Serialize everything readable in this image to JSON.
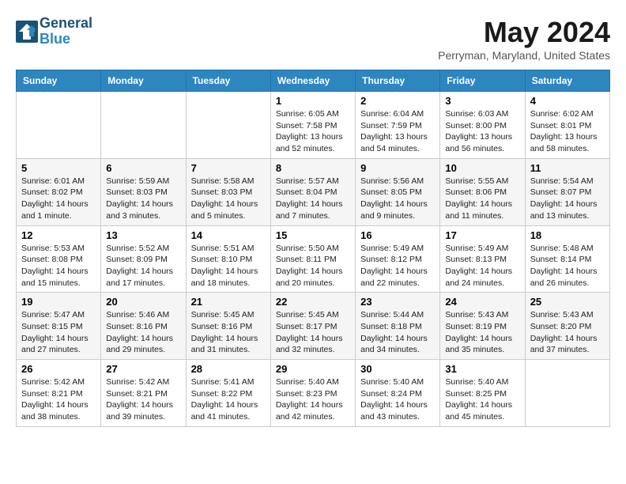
{
  "header": {
    "logo_line1": "General",
    "logo_line2": "Blue",
    "month_title": "May 2024",
    "location": "Perryman, Maryland, United States"
  },
  "days_of_week": [
    "Sunday",
    "Monday",
    "Tuesday",
    "Wednesday",
    "Thursday",
    "Friday",
    "Saturday"
  ],
  "weeks": [
    [
      {
        "day": "",
        "sunrise": "",
        "sunset": "",
        "daylight": ""
      },
      {
        "day": "",
        "sunrise": "",
        "sunset": "",
        "daylight": ""
      },
      {
        "day": "",
        "sunrise": "",
        "sunset": "",
        "daylight": ""
      },
      {
        "day": "1",
        "sunrise": "Sunrise: 6:05 AM",
        "sunset": "Sunset: 7:58 PM",
        "daylight": "Daylight: 13 hours and 52 minutes."
      },
      {
        "day": "2",
        "sunrise": "Sunrise: 6:04 AM",
        "sunset": "Sunset: 7:59 PM",
        "daylight": "Daylight: 13 hours and 54 minutes."
      },
      {
        "day": "3",
        "sunrise": "Sunrise: 6:03 AM",
        "sunset": "Sunset: 8:00 PM",
        "daylight": "Daylight: 13 hours and 56 minutes."
      },
      {
        "day": "4",
        "sunrise": "Sunrise: 6:02 AM",
        "sunset": "Sunset: 8:01 PM",
        "daylight": "Daylight: 13 hours and 58 minutes."
      }
    ],
    [
      {
        "day": "5",
        "sunrise": "Sunrise: 6:01 AM",
        "sunset": "Sunset: 8:02 PM",
        "daylight": "Daylight: 14 hours and 1 minute."
      },
      {
        "day": "6",
        "sunrise": "Sunrise: 5:59 AM",
        "sunset": "Sunset: 8:03 PM",
        "daylight": "Daylight: 14 hours and 3 minutes."
      },
      {
        "day": "7",
        "sunrise": "Sunrise: 5:58 AM",
        "sunset": "Sunset: 8:03 PM",
        "daylight": "Daylight: 14 hours and 5 minutes."
      },
      {
        "day": "8",
        "sunrise": "Sunrise: 5:57 AM",
        "sunset": "Sunset: 8:04 PM",
        "daylight": "Daylight: 14 hours and 7 minutes."
      },
      {
        "day": "9",
        "sunrise": "Sunrise: 5:56 AM",
        "sunset": "Sunset: 8:05 PM",
        "daylight": "Daylight: 14 hours and 9 minutes."
      },
      {
        "day": "10",
        "sunrise": "Sunrise: 5:55 AM",
        "sunset": "Sunset: 8:06 PM",
        "daylight": "Daylight: 14 hours and 11 minutes."
      },
      {
        "day": "11",
        "sunrise": "Sunrise: 5:54 AM",
        "sunset": "Sunset: 8:07 PM",
        "daylight": "Daylight: 14 hours and 13 minutes."
      }
    ],
    [
      {
        "day": "12",
        "sunrise": "Sunrise: 5:53 AM",
        "sunset": "Sunset: 8:08 PM",
        "daylight": "Daylight: 14 hours and 15 minutes."
      },
      {
        "day": "13",
        "sunrise": "Sunrise: 5:52 AM",
        "sunset": "Sunset: 8:09 PM",
        "daylight": "Daylight: 14 hours and 17 minutes."
      },
      {
        "day": "14",
        "sunrise": "Sunrise: 5:51 AM",
        "sunset": "Sunset: 8:10 PM",
        "daylight": "Daylight: 14 hours and 18 minutes."
      },
      {
        "day": "15",
        "sunrise": "Sunrise: 5:50 AM",
        "sunset": "Sunset: 8:11 PM",
        "daylight": "Daylight: 14 hours and 20 minutes."
      },
      {
        "day": "16",
        "sunrise": "Sunrise: 5:49 AM",
        "sunset": "Sunset: 8:12 PM",
        "daylight": "Daylight: 14 hours and 22 minutes."
      },
      {
        "day": "17",
        "sunrise": "Sunrise: 5:49 AM",
        "sunset": "Sunset: 8:13 PM",
        "daylight": "Daylight: 14 hours and 24 minutes."
      },
      {
        "day": "18",
        "sunrise": "Sunrise: 5:48 AM",
        "sunset": "Sunset: 8:14 PM",
        "daylight": "Daylight: 14 hours and 26 minutes."
      }
    ],
    [
      {
        "day": "19",
        "sunrise": "Sunrise: 5:47 AM",
        "sunset": "Sunset: 8:15 PM",
        "daylight": "Daylight: 14 hours and 27 minutes."
      },
      {
        "day": "20",
        "sunrise": "Sunrise: 5:46 AM",
        "sunset": "Sunset: 8:16 PM",
        "daylight": "Daylight: 14 hours and 29 minutes."
      },
      {
        "day": "21",
        "sunrise": "Sunrise: 5:45 AM",
        "sunset": "Sunset: 8:16 PM",
        "daylight": "Daylight: 14 hours and 31 minutes."
      },
      {
        "day": "22",
        "sunrise": "Sunrise: 5:45 AM",
        "sunset": "Sunset: 8:17 PM",
        "daylight": "Daylight: 14 hours and 32 minutes."
      },
      {
        "day": "23",
        "sunrise": "Sunrise: 5:44 AM",
        "sunset": "Sunset: 8:18 PM",
        "daylight": "Daylight: 14 hours and 34 minutes."
      },
      {
        "day": "24",
        "sunrise": "Sunrise: 5:43 AM",
        "sunset": "Sunset: 8:19 PM",
        "daylight": "Daylight: 14 hours and 35 minutes."
      },
      {
        "day": "25",
        "sunrise": "Sunrise: 5:43 AM",
        "sunset": "Sunset: 8:20 PM",
        "daylight": "Daylight: 14 hours and 37 minutes."
      }
    ],
    [
      {
        "day": "26",
        "sunrise": "Sunrise: 5:42 AM",
        "sunset": "Sunset: 8:21 PM",
        "daylight": "Daylight: 14 hours and 38 minutes."
      },
      {
        "day": "27",
        "sunrise": "Sunrise: 5:42 AM",
        "sunset": "Sunset: 8:21 PM",
        "daylight": "Daylight: 14 hours and 39 minutes."
      },
      {
        "day": "28",
        "sunrise": "Sunrise: 5:41 AM",
        "sunset": "Sunset: 8:22 PM",
        "daylight": "Daylight: 14 hours and 41 minutes."
      },
      {
        "day": "29",
        "sunrise": "Sunrise: 5:40 AM",
        "sunset": "Sunset: 8:23 PM",
        "daylight": "Daylight: 14 hours and 42 minutes."
      },
      {
        "day": "30",
        "sunrise": "Sunrise: 5:40 AM",
        "sunset": "Sunset: 8:24 PM",
        "daylight": "Daylight: 14 hours and 43 minutes."
      },
      {
        "day": "31",
        "sunrise": "Sunrise: 5:40 AM",
        "sunset": "Sunset: 8:25 PM",
        "daylight": "Daylight: 14 hours and 45 minutes."
      },
      {
        "day": "",
        "sunrise": "",
        "sunset": "",
        "daylight": ""
      }
    ]
  ]
}
